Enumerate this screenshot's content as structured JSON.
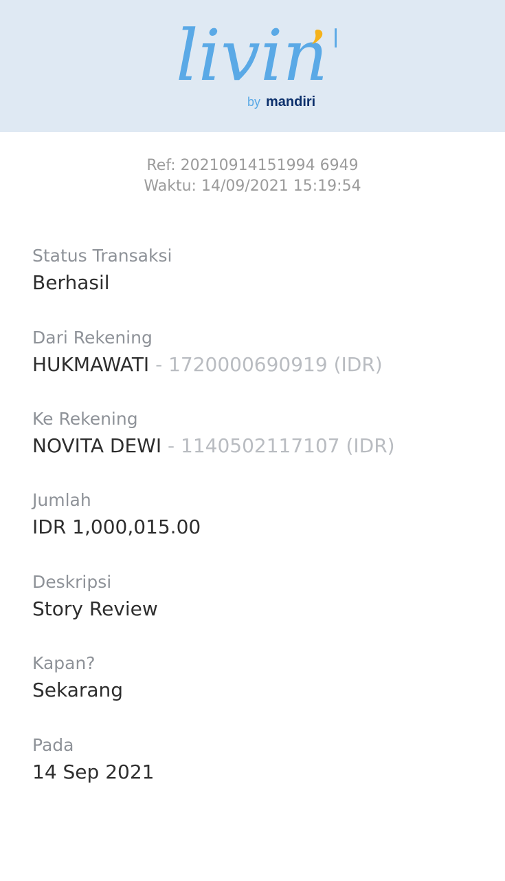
{
  "header": {
    "logo_word": "livin'",
    "logo_by": "by",
    "logo_brand": "mandiri",
    "colors": {
      "background": "#dfe9f3",
      "logo_blue": "#5aa9e6",
      "accent_yellow": "#f5b21b",
      "brand_navy": "#0b2f6b"
    }
  },
  "reference": {
    "ref": "Ref: 20210914151994 6949",
    "time": "Waktu: 14/09/2021 15:19:54"
  },
  "fields": {
    "status": {
      "label": "Status Transaksi",
      "value": "Berhasil"
    },
    "from": {
      "label": "Dari Rekening",
      "name": "HUKMAWATI",
      "account": " - 1720000690919 (IDR)"
    },
    "to": {
      "label": "Ke Rekening",
      "name": "NOVITA DEWI",
      "account": " - 1140502117107 (IDR)"
    },
    "amount": {
      "label": "Jumlah",
      "value": "IDR 1,000,015.00"
    },
    "description": {
      "label": "Deskripsi",
      "value": "Story Review"
    },
    "when": {
      "label": "Kapan?",
      "value": "Sekarang"
    },
    "date": {
      "label": "Pada",
      "value": "14 Sep 2021"
    }
  }
}
